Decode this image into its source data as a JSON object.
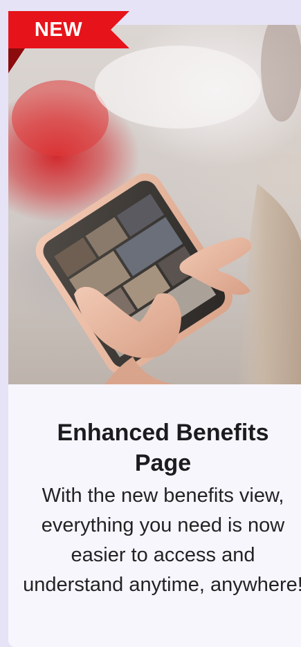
{
  "badge": {
    "label": "NEW",
    "color": "#e6141a",
    "fold_color": "#8c0b0d"
  },
  "hero_image": {
    "subject": "hand holding smartphone showing photo gallery",
    "icon": "smartphone-photo"
  },
  "content": {
    "title": "Enhanced Benefits Page",
    "description": "With the new benefits view, everything you need is now easier to access and understand anytime, anywhere!"
  },
  "colors": {
    "page_background": "#e6e3f6",
    "panel_background": "#f7f6fd",
    "title_text": "#1c1c1e"
  }
}
